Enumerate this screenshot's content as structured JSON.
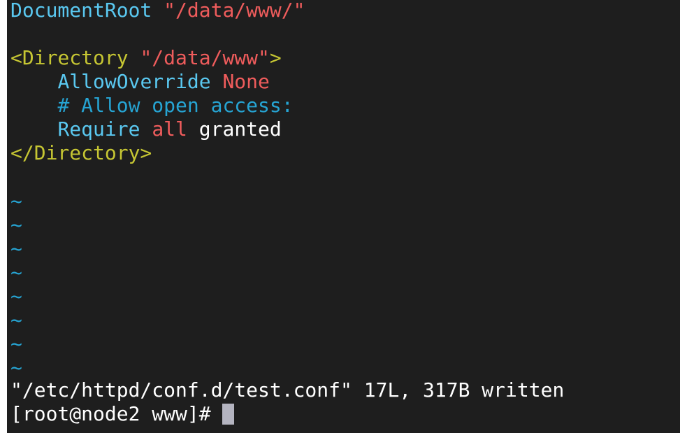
{
  "editor": {
    "line1": {
      "keyword": "DocumentRoot",
      "value": "\"/data/www/\""
    },
    "line2": {
      "tag_open": "<Directory",
      "path": "\"/data/www\"",
      "tag_close": ">"
    },
    "line3": {
      "keyword": "AllowOverride",
      "value": "None"
    },
    "line4": {
      "comment": "# Allow open access:"
    },
    "line5": {
      "keyword": "Require",
      "value1": "all",
      "value2": "granted"
    },
    "line6": {
      "tag": "</Directory>"
    },
    "empty_line_marker": "~"
  },
  "status_message": "\"/etc/httpd/conf.d/test.conf\" 17L, 317B written",
  "shell_prompt": "[root@node2 www]#",
  "colors": {
    "background": "#1e1e1e",
    "keyword": "#5ac8f0",
    "string": "#ef5c5c",
    "tag": "#c6c633",
    "comment": "#26a4d3",
    "text": "#ffffff",
    "cursor": "#b4b4c0"
  }
}
